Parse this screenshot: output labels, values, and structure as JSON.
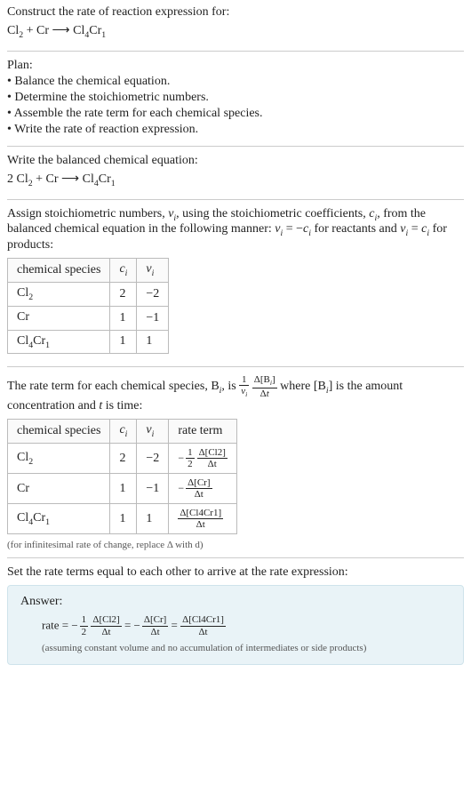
{
  "intro": {
    "construct": "Construct the rate of reaction expression for:",
    "equation_lhs_a": "Cl",
    "equation_lhs_a_sub": "2",
    "plus": " + Cr ",
    "arrow": "⟶",
    "prod_a": " Cl",
    "prod_a_sub": "4",
    "prod_b": "Cr",
    "prod_b_sub": "1"
  },
  "plan": {
    "heading": "Plan:",
    "l1": "• Balance the chemical equation.",
    "l2": "• Determine the stoichiometric numbers.",
    "l3": "• Assemble the rate term for each chemical species.",
    "l4": "• Write the rate of reaction expression."
  },
  "balanced": {
    "heading": "Write the balanced chemical equation:",
    "eq_pre": "2 Cl",
    "eq_sub1": "2",
    "eq_mid": " + Cr ",
    "arrow": "⟶",
    "eq_prod": " Cl",
    "eq_sub2": "4",
    "eq_prod2": "Cr",
    "eq_sub3": "1"
  },
  "assign": {
    "p1a": "Assign stoichiometric numbers, ",
    "nu": "ν",
    "i": "i",
    "p1b": ", using the stoichiometric coefficients, ",
    "c": "c",
    "p1c": ", from the balanced chemical equation in the following manner: ",
    "eq1a": " = −",
    "p1d": " for reactants and ",
    "eq2a": " = ",
    "p1e": " for products:",
    "th_species": "chemical species",
    "th_ci": "c",
    "th_nui": "ν",
    "rows": [
      {
        "a": "Cl",
        "asub": "2",
        "b": "",
        "bsub": "",
        "c": "2",
        "nu": "−2"
      },
      {
        "a": "Cr",
        "asub": "",
        "b": "",
        "bsub": "",
        "c": "1",
        "nu": "−1"
      },
      {
        "a": "Cl",
        "asub": "4",
        "b": "Cr",
        "bsub": "1",
        "c": "1",
        "nu": "1"
      }
    ]
  },
  "rate_term": {
    "p1a": "The rate term for each chemical species, B",
    "p1b": ", is ",
    "frac1_num": "1",
    "p1c": " where [B",
    "p1d": "] is the amount concentration and ",
    "t": "t",
    "p1e": " is time:",
    "th_species": "chemical species",
    "th_ci": "c",
    "th_nui": "ν",
    "th_rate": "rate term",
    "rows": [
      {
        "a": "Cl",
        "asub": "2",
        "b": "",
        "bsub": "",
        "c": "2",
        "nu": "−2",
        "coef_num": "1",
        "coef_den": "2",
        "neg": "−",
        "dnum": "Δ[Cl2]",
        "dden": "Δt"
      },
      {
        "a": "Cr",
        "asub": "",
        "b": "",
        "bsub": "",
        "c": "1",
        "nu": "−1",
        "coef_num": "",
        "coef_den": "",
        "neg": "−",
        "dnum": "Δ[Cr]",
        "dden": "Δt"
      },
      {
        "a": "Cl",
        "asub": "4",
        "b": "Cr",
        "bsub": "1",
        "c": "1",
        "nu": "1",
        "coef_num": "",
        "coef_den": "",
        "neg": "",
        "dnum": "Δ[Cl4Cr1]",
        "dden": "Δt"
      }
    ],
    "note": "(for infinitesimal rate of change, replace Δ with d)"
  },
  "set_equal": {
    "heading": "Set the rate terms equal to each other to arrive at the rate expression:"
  },
  "answer": {
    "label": "Answer:",
    "rate_eq": "rate = ",
    "neg": "−",
    "half_num": "1",
    "half_den": "2",
    "t1_num": "Δ[Cl2]",
    "t1_den": "Δt",
    "eq": " = ",
    "t2_num": "Δ[Cr]",
    "t2_den": "Δt",
    "t3_num": "Δ[Cl4Cr1]",
    "t3_den": "Δt",
    "assume": "(assuming constant volume and no accumulation of intermediates or side products)"
  }
}
